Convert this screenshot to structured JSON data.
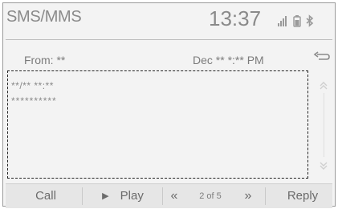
{
  "header": {
    "title": "SMS/MMS",
    "clock": "13:37",
    "status_icons": [
      "signal-icon",
      "battery-icon",
      "bluetooth-icon"
    ]
  },
  "message": {
    "from": "From: **",
    "date": "Dec ** *:** PM",
    "time": "**/** **:**",
    "body": "**********"
  },
  "footer": {
    "call_label": "Call",
    "play_label": "Play",
    "prev_label": "«",
    "page_indicator": "2 of 5",
    "next_label": "»",
    "reply_label": "Reply"
  },
  "colors": {
    "background": "#f3f3f3",
    "text": "#7b7b7b",
    "footer": "#e6e6e6",
    "highlight_border": "#222222"
  }
}
